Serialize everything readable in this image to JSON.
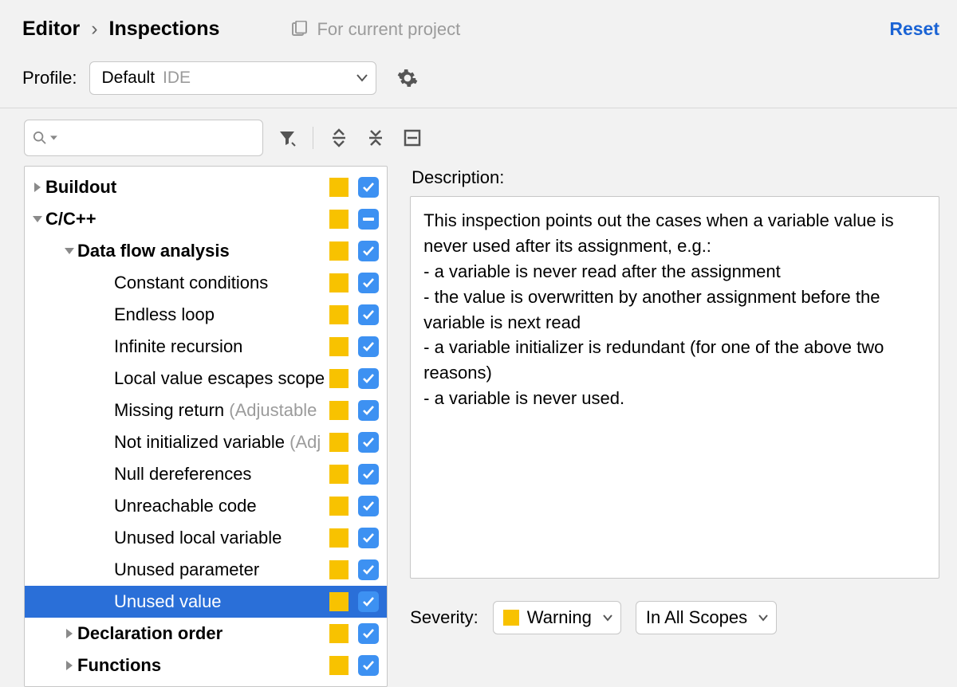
{
  "header": {
    "breadcrumb_root": "Editor",
    "breadcrumb_leaf": "Inspections",
    "scope_text": "For current project",
    "reset": "Reset"
  },
  "profile": {
    "label": "Profile:",
    "name": "Default",
    "scope": "IDE"
  },
  "search": {
    "placeholder": ""
  },
  "description": {
    "label": "Description:",
    "body": "This inspection points out the cases when a variable value is never used after its assignment, e.g.:\n  - a variable is never read after the assignment\n  - the value is overwritten by another assignment before the variable is next read\n  - a variable initializer is redundant (for one of the above two reasons)\n  - a variable is never used."
  },
  "severity": {
    "label": "Severity:",
    "level": "Warning",
    "scope": "In All Scopes"
  },
  "tree": {
    "0": {
      "label": "Buildout",
      "annotation": ""
    },
    "1": {
      "label": "C/C++",
      "annotation": ""
    },
    "2": {
      "label": "Data flow analysis",
      "annotation": ""
    },
    "3": {
      "label": "Constant conditions",
      "annotation": ""
    },
    "4": {
      "label": "Endless loop",
      "annotation": ""
    },
    "5": {
      "label": "Infinite recursion",
      "annotation": ""
    },
    "6": {
      "label": "Local value escapes scope",
      "annotation": ""
    },
    "7": {
      "label": "Missing return",
      "annotation": " (Adjustable"
    },
    "8": {
      "label": "Not initialized variable",
      "annotation": " (Adj"
    },
    "9": {
      "label": "Null dereferences",
      "annotation": ""
    },
    "10": {
      "label": "Unreachable code",
      "annotation": ""
    },
    "11": {
      "label": "Unused local variable",
      "annotation": ""
    },
    "12": {
      "label": "Unused parameter",
      "annotation": ""
    },
    "13": {
      "label": "Unused value",
      "annotation": ""
    },
    "14": {
      "label": "Declaration order",
      "annotation": ""
    },
    "15": {
      "label": "Functions",
      "annotation": ""
    }
  }
}
